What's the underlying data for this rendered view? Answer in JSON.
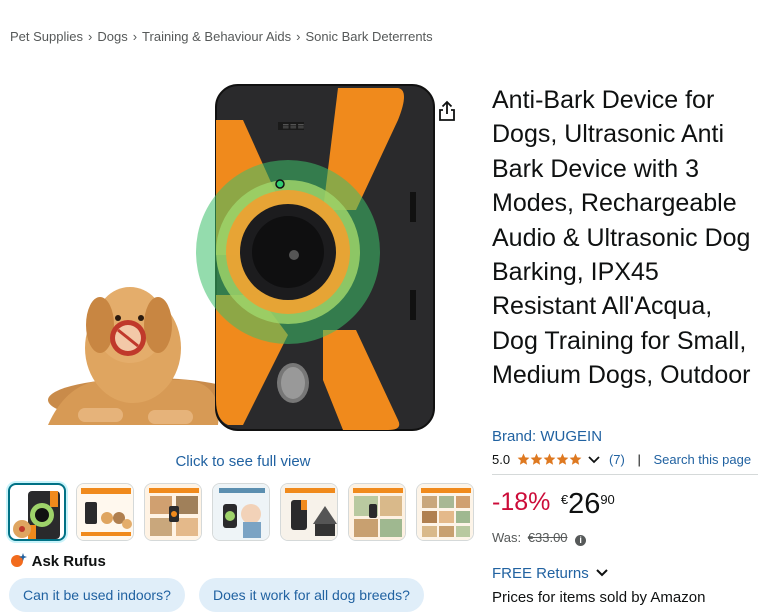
{
  "breadcrumb": [
    "Pet Supplies",
    "Dogs",
    "Training & Behaviour Aids",
    "Sonic Bark Deterrents"
  ],
  "breadcrumb_sep": "›",
  "image": {
    "click_full_view": "Click to see full view",
    "thumbnail_count": 7
  },
  "rufus": {
    "label": "Ask Rufus",
    "chips": [
      "Can it be used indoors?",
      "Does it work for all dog breeds?"
    ]
  },
  "product": {
    "title": "Anti-Bark Device for Dogs, Ultrasonic Anti Bark Device with 3 Modes, Rechargeable Audio & Ultrasonic Dog Barking, IPX45 Resistant All'Acqua, Dog Training for Small, Medium Dogs, Outdoor",
    "brand": "Brand: WUGEIN",
    "rating": "5.0",
    "stars": 5,
    "rating_count": "(7)",
    "search_page": "Search this page",
    "discount": "-18%",
    "currency": "€",
    "price_whole": "26",
    "price_fraction": "90",
    "was_label": "Was:",
    "was_price": "€33.00",
    "returns": "FREE Returns",
    "prices_note": "Prices for items sold by Amazon"
  },
  "colors": {
    "link": "#2162a1",
    "deal_red": "#cc0c39",
    "star": "#de7921",
    "device_orange": "#f08a1c",
    "chip_bg": "#e0eef9"
  }
}
